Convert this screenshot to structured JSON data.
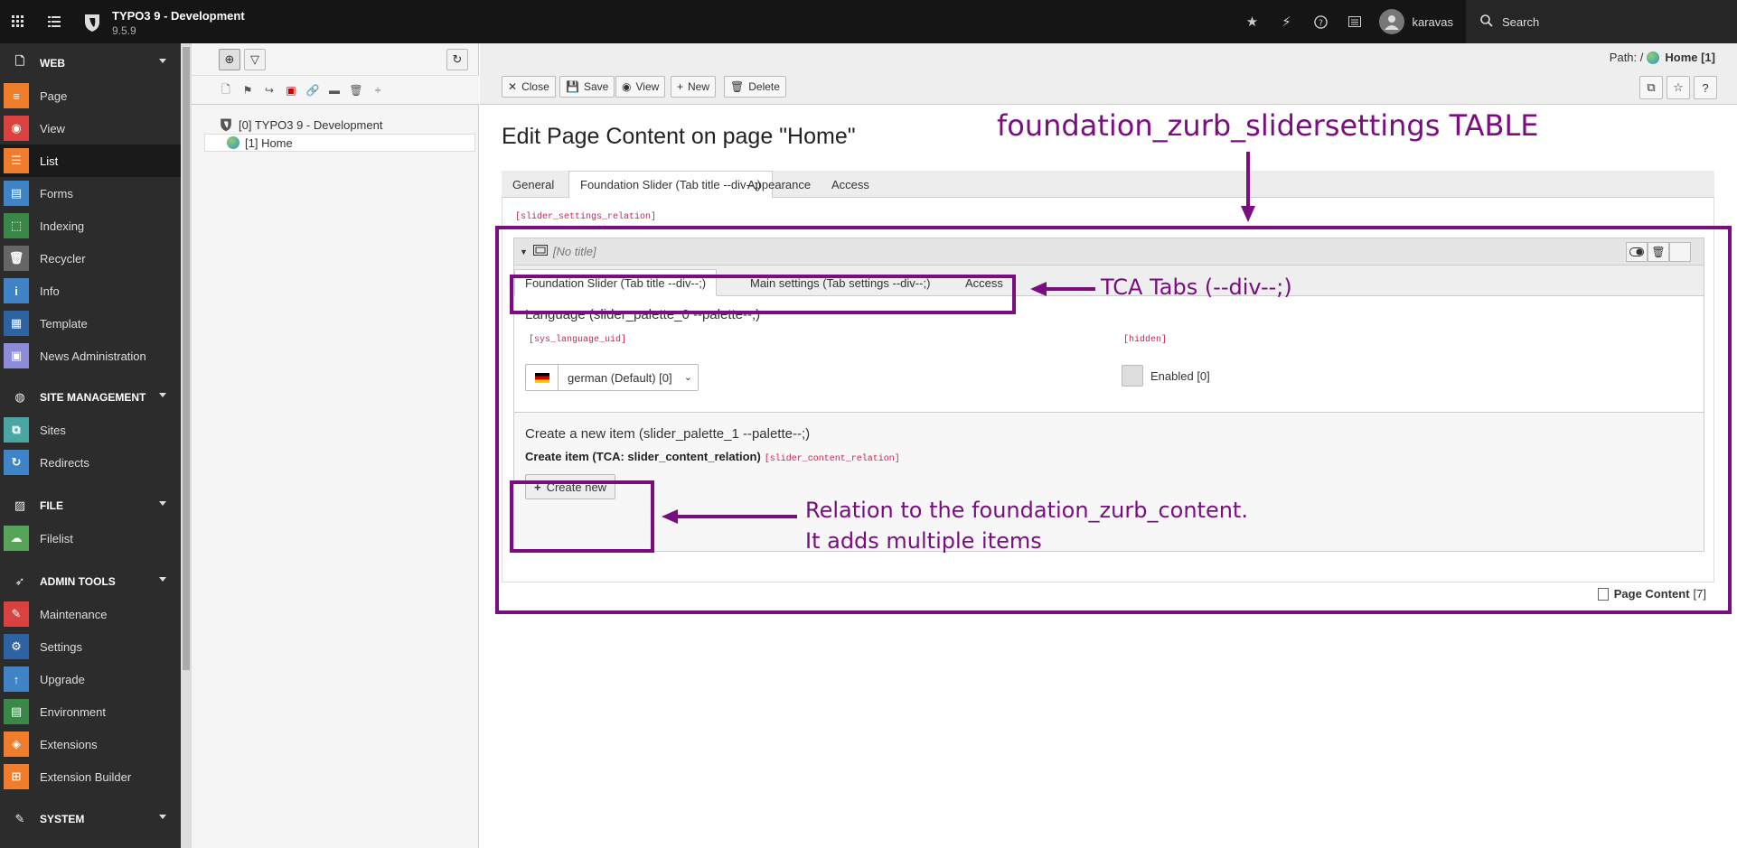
{
  "topbar": {
    "site_name": "TYPO3 9 - Development",
    "site_version": "9.5.9",
    "username": "karavas",
    "search_label": "Search",
    "icons": [
      "apps-icon",
      "list-icon",
      "typo3-logo",
      "star-icon",
      "flash-icon",
      "help-icon",
      "list-view-icon",
      "user-icon",
      "search-icon"
    ]
  },
  "modules": {
    "groups": {
      "web": "WEB",
      "site": "SITE MANAGEMENT",
      "file": "FILE",
      "admin": "ADMIN TOOLS",
      "system": "SYSTEM"
    },
    "items": {
      "page": "Page",
      "view": "View",
      "list": "List",
      "forms": "Forms",
      "indexing": "Indexing",
      "recycler": "Recycler",
      "info": "Info",
      "template": "Template",
      "news": "News Administration",
      "sites": "Sites",
      "redirects": "Redirects",
      "filelist": "Filelist",
      "maintenance": "Maintenance",
      "settings": "Settings",
      "upgrade": "Upgrade",
      "environment": "Environment",
      "extensions": "Extensions",
      "extbuilder": "Extension Builder"
    },
    "active": "List"
  },
  "pagetree": {
    "root": "[0] TYPO3 9 - Development",
    "home": "[1] Home"
  },
  "docheader": {
    "path_label": "Path: /",
    "path_page": "Home [1]",
    "buttons": {
      "close": "Close",
      "save": "Save",
      "view": "View",
      "new": "New",
      "delete": "Delete"
    }
  },
  "editor": {
    "title": "Edit Page Content on page \"Home\"",
    "tabs": {
      "general": "General",
      "slider": "Foundation Slider (Tab title --div--;)",
      "appearance": "Appearance",
      "access": "Access"
    },
    "relation_tag": "[slider_settings_relation]",
    "inline_record": {
      "title": "[No title]",
      "tabs": {
        "slider": "Foundation Slider (Tab title --div--;)",
        "main": "Main settings (Tab settings --div--;)",
        "access": "Access"
      },
      "palette0_title": "Language (slider_palette_0 --palette--;)",
      "sys_language_tag": "[sys_language_uid]",
      "hidden_tag": "[hidden]",
      "language_value": "german (Default) [0]",
      "enabled_label": "Enabled [0]",
      "palette1_title": "Create a new item (slider_palette_1 --palette--;)",
      "create_item_label": "Create item (TCA: slider_content_relation)",
      "content_relation_tag": "[slider_content_relation]",
      "create_new": "Create new"
    },
    "footer_label": "Page Content",
    "footer_uid": "[7]"
  },
  "annotations": {
    "table_title": "foundation_zurb_slidersettings TABLE",
    "tca_tabs": "TCA Tabs (--div--;)",
    "relation_line1": "Relation to the foundation_zurb_content.",
    "relation_line2": "It adds multiple items",
    "color": "#7a0e80"
  }
}
